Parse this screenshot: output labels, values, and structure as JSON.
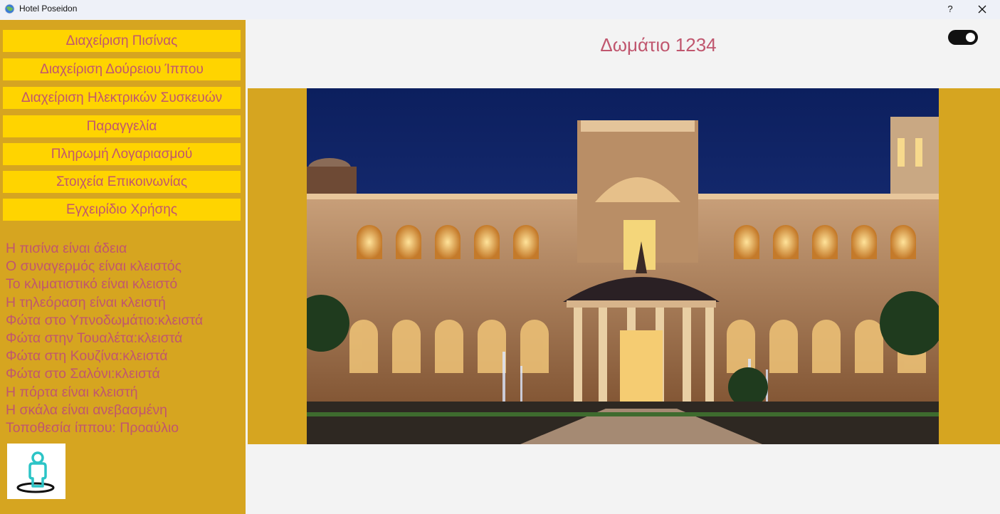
{
  "window": {
    "title": "Hotel Poseidon",
    "help_label": "?"
  },
  "sidebar": {
    "menu": [
      {
        "label": "Διαχείριση Πισίνας"
      },
      {
        "label": "Διαχείριση Δούρειου Ίππου"
      },
      {
        "label": "Διαχείριση Ηλεκτρικών Συσκευών"
      },
      {
        "label": "Παραγγελία"
      },
      {
        "label": "Πληρωμή Λογαριασμού"
      },
      {
        "label": "Στοιχεία Επικοινωνίας"
      },
      {
        "label": "Εγχειρίδιο Χρήσης"
      }
    ],
    "status": [
      "Η πισίνα είναι άδεια",
      "Ο συναγερμός είναι κλειστός",
      "Το κλιματιστικό είναι κλειστό",
      "Η τηλεόραση είναι κλειστή",
      "Φώτα στο Υπνοδωμάτιο:κλειστά",
      "Φώτα στην Τουαλέτα:κλειστά",
      "Φώτα στη Κουζίνα:κλειστά",
      "Φώτα στο Σαλόνι:κλειστά",
      "Η πόρτα είναι κλειστή",
      "Η σκάλα είναι ανεβασμένη",
      "Τοποθεσία ίππου: Προαύλιο"
    ],
    "user_icon": "person-location-icon"
  },
  "main": {
    "room_title": "Δωμάτιο 1234",
    "toggle_on": true,
    "hero_image": "hotel-palace-night-photo"
  },
  "colors": {
    "sidebar_bg": "#d6a520",
    "button_bg": "#ffd400",
    "text_accent": "#c0566e",
    "main_bg": "#f3f3f3"
  }
}
